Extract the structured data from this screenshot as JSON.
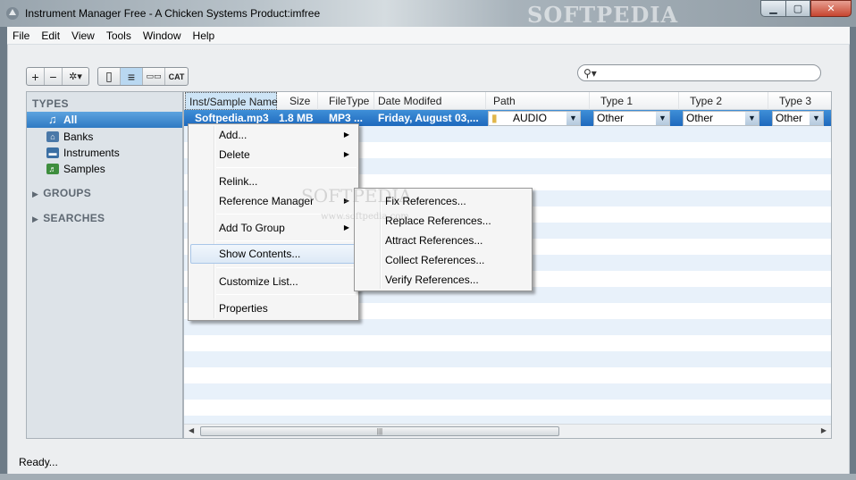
{
  "window": {
    "title": "Instrument Manager Free - A Chicken Systems Product:imfree",
    "watermark": "SOFTPEDIA",
    "buttons": {
      "minimize": "▁",
      "maximize": "▢",
      "close": "✕"
    }
  },
  "menubar": [
    "File",
    "Edit",
    "View",
    "Tools",
    "Window",
    "Help"
  ],
  "toolbar": {
    "add": "+",
    "remove": "−",
    "settings": "✲▾",
    "view_modes": [
      "▯",
      "≡",
      "▭▭",
      "CAT"
    ],
    "search_icon": "magnifier-icon"
  },
  "sidebar": {
    "types_header": "TYPES",
    "items": [
      {
        "label": "All",
        "icon": "note-icon",
        "selected": true
      },
      {
        "label": "Banks",
        "icon": "bank-icon"
      },
      {
        "label": "Instruments",
        "icon": "instrument-icon"
      },
      {
        "label": "Samples",
        "icon": "speaker-icon"
      }
    ],
    "groups_header": "GROUPS",
    "searches_header": "SEARCHES"
  },
  "table": {
    "columns": [
      "Inst/Sample Name",
      "Size",
      "FileType",
      "Date Modifed",
      "Path",
      "Type 1",
      "Type 2",
      "Type 3"
    ],
    "selected_row": {
      "name": "Softpedia.mp3",
      "size": "1.8 MB",
      "filetype": "MP3 ...",
      "date": "Friday, August 03,...",
      "path": "AUDIO",
      "type1": "Other",
      "type2": "Other",
      "type3": "Other"
    }
  },
  "context_menu": {
    "items": [
      "Add...",
      "Delete",
      "Relink...",
      "Reference Manager",
      "Add To Group",
      "Show Contents...",
      "Customize List...",
      "Properties"
    ],
    "highlighted": "Show Contents..."
  },
  "submenu": {
    "items": [
      "Fix References...",
      "Replace References...",
      "Attract References...",
      "Collect References...",
      "Verify References..."
    ],
    "watermark_big": "SOFTPEDIA",
    "watermark_small": "www.softpedia.com"
  },
  "status": "Ready...",
  "colors": {
    "selection": "#2f7ac3",
    "stripe": "#e8f1fa",
    "sidebar": "#dde3e8"
  }
}
